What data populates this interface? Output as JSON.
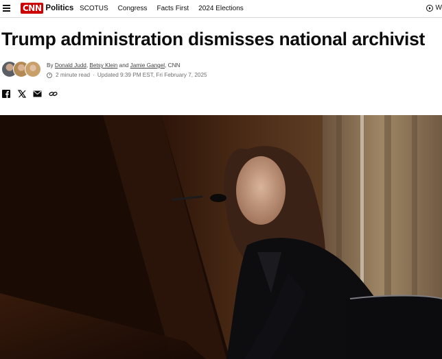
{
  "header": {
    "logo_text": "CNN",
    "section": "Politics",
    "nav": [
      "SCOTUS",
      "Congress",
      "Facts First",
      "2024 Elections"
    ],
    "watch_label": "W",
    "brand_color": "#cc0000"
  },
  "article": {
    "headline": "Trump administration dismisses national archivist",
    "byline": {
      "prefix": "By",
      "authors": [
        "Donald Judd",
        "Betsy Klein",
        "Jamie Gangel"
      ],
      "sep1": ",",
      "conj": "and",
      "outlet": ", CNN"
    },
    "read_time": "2 minute read",
    "updated": "Updated 9:39 PM EST, Fri February 7, 2025"
  },
  "share": {
    "icons": [
      "facebook-icon",
      "x-icon",
      "email-icon",
      "link-icon"
    ]
  },
  "photo": {
    "alt": "photo"
  }
}
